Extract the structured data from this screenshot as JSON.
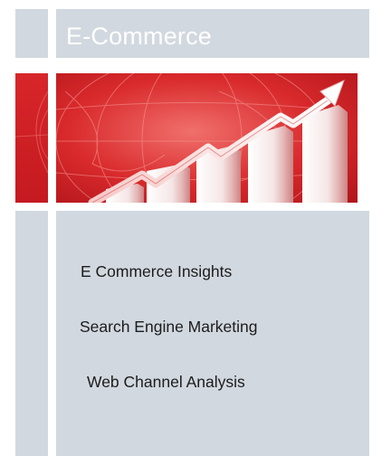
{
  "header": {
    "title": "E-Commerce"
  },
  "banner": {
    "image": "ecommerce-growth-chart-banner"
  },
  "menu": {
    "items": [
      {
        "label": "E Commerce Insights"
      },
      {
        "label": "Search Engine Marketing"
      },
      {
        "label": "Web Channel Analysis"
      }
    ]
  },
  "colors": {
    "panel": "#d2d8df",
    "banner_red": "#d52428",
    "text": "#1c1c1c",
    "title_text": "#ffffff"
  }
}
